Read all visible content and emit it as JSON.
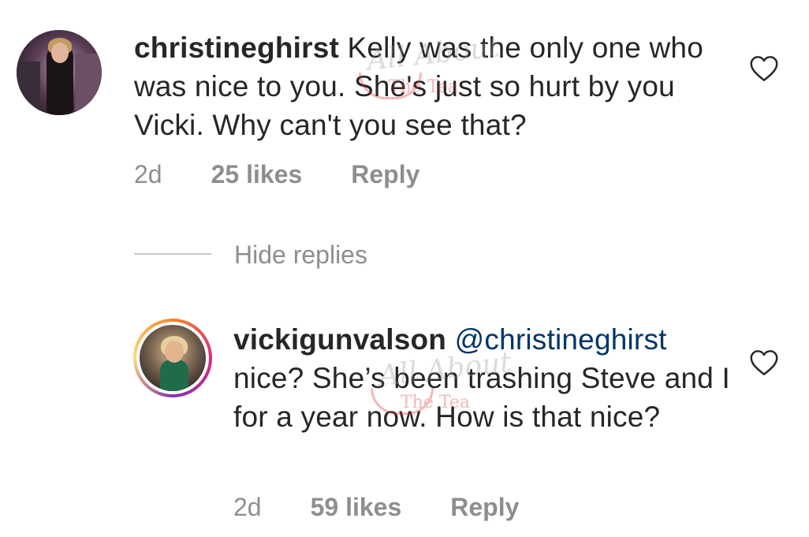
{
  "comments": [
    {
      "username": "christineghirst",
      "text": " Kelly was the only one who was nice to you.  She's just so hurt by you Vicki. Why can't you see that?",
      "time": "2d",
      "likes": "25 likes",
      "reply": "Reply"
    },
    {
      "username": "vickigunvalson",
      "mention": "@christineghirst",
      "text": " nice? She’s been trashing Steve and I for a year now. How is that nice?",
      "time": "2d",
      "likes": "59 likes",
      "reply": "Reply"
    }
  ],
  "hide_replies": "Hide replies",
  "watermark": {
    "script": "All About",
    "sub": "The Tea"
  },
  "icons": {
    "like": "heart-outline-icon"
  },
  "colors": {
    "text": "#262626",
    "muted": "#8e8e8e",
    "mention": "#003569"
  }
}
